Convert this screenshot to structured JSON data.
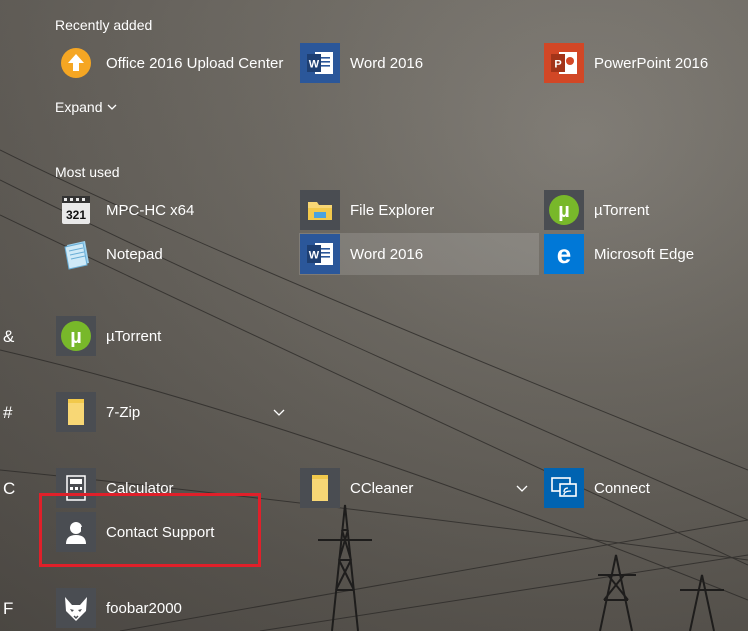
{
  "recently_added": {
    "header": "Recently added",
    "items": [
      {
        "label": "Office 2016 Upload Center",
        "icon": "upload-arrow-icon"
      },
      {
        "label": "Word 2016",
        "icon": "word-icon"
      },
      {
        "label": "PowerPoint 2016",
        "icon": "powerpoint-icon"
      }
    ],
    "expand_label": "Expand"
  },
  "most_used": {
    "header": "Most used",
    "items": [
      {
        "label": "MPC-HC x64",
        "icon": "mpc-hc-icon"
      },
      {
        "label": "File Explorer",
        "icon": "folder-icon"
      },
      {
        "label": "µTorrent",
        "icon": "utorrent-icon"
      },
      {
        "label": "Notepad",
        "icon": "notepad-icon"
      },
      {
        "label": "Word 2016",
        "icon": "word-icon"
      },
      {
        "label": "Microsoft Edge",
        "icon": "edge-icon"
      }
    ]
  },
  "groups": {
    "amp": {
      "letter": "&",
      "items": [
        {
          "label": "µTorrent",
          "icon": "utorrent-icon"
        }
      ]
    },
    "hash": {
      "letter": "#",
      "items": [
        {
          "label": "7-Zip",
          "icon": "folder-icon"
        }
      ]
    },
    "c": {
      "letter": "C",
      "items": [
        {
          "label": "Calculator",
          "icon": "calculator-icon"
        },
        {
          "label": "CCleaner",
          "icon": "folder-icon"
        },
        {
          "label": "Connect",
          "icon": "connect-icon"
        },
        {
          "label": "Contact Support",
          "icon": "contact-support-icon"
        }
      ]
    },
    "f": {
      "letter": "F",
      "items": [
        {
          "label": "foobar2000",
          "icon": "foobar-icon"
        }
      ]
    }
  },
  "colors": {
    "accent_highlight": "#e0202a",
    "word_blue": "#2b579a",
    "powerpoint_orange": "#d24726",
    "edge_blue": "#0078d7",
    "connect_blue": "#0063b1",
    "utorrent_green": "#78b82a",
    "tile_gray": "#4a4d52"
  }
}
